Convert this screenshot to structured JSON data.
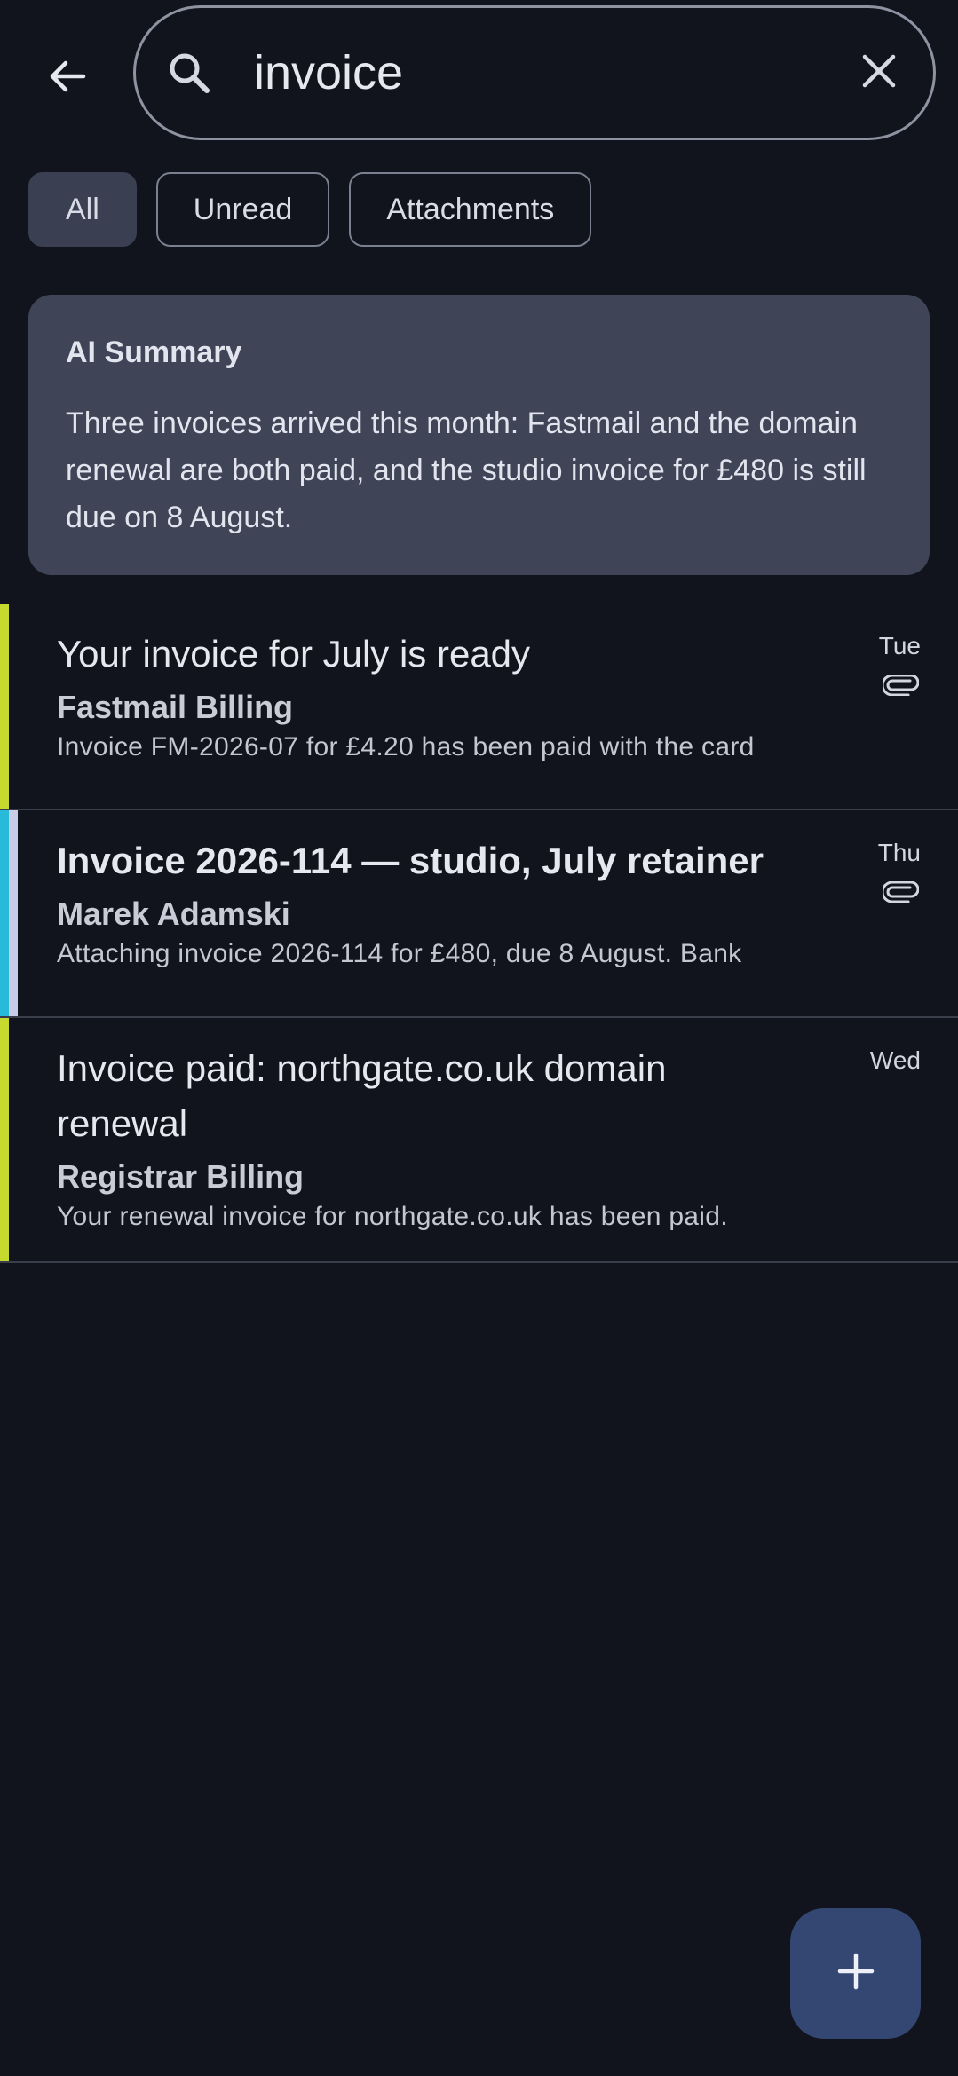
{
  "search": {
    "query": "invoice",
    "back_icon": "arrow-left-icon",
    "search_icon": "search-icon",
    "clear_icon": "close-icon"
  },
  "filters": [
    {
      "label": "All",
      "selected": true
    },
    {
      "label": "Unread",
      "selected": false
    },
    {
      "label": "Attachments",
      "selected": false
    }
  ],
  "summary": {
    "title": "AI Summary",
    "text": "Three invoices arrived this month: Fastmail and the domain renewal are both paid, and the studio invoice for £480 is still due on 8 August."
  },
  "messages": [
    {
      "subject": "Your invoice for July is ready",
      "sender": "Fastmail Billing",
      "preview": "Invoice FM-2026-07 for £4.20 has been paid with the card",
      "date": "Tue",
      "has_attachment": true,
      "unread": false,
      "accent_color": "#c6d92f"
    },
    {
      "subject": "Invoice 2026-114 — studio, July retainer",
      "sender": "Marek Adamski",
      "preview": "Attaching invoice 2026-114 for £480, due 8 August. Bank",
      "date": "Thu",
      "has_attachment": true,
      "unread": true,
      "accent_color": "#29b9d9"
    },
    {
      "subject": "Invoice paid: northgate.co.uk domain renewal",
      "sender": "Registrar Billing",
      "preview": "Your renewal invoice for northgate.co.uk has been paid.",
      "date": "Wed",
      "has_attachment": false,
      "unread": false,
      "accent_color": "#c6d92f"
    }
  ],
  "fab": {
    "icon": "plus-icon"
  },
  "colors": {
    "background": "#11141d",
    "card": "#3f4457",
    "chip_active": "#3a4052",
    "fab": "#344672",
    "accent_green": "#c6d92f",
    "accent_cyan": "#29b9d9"
  }
}
